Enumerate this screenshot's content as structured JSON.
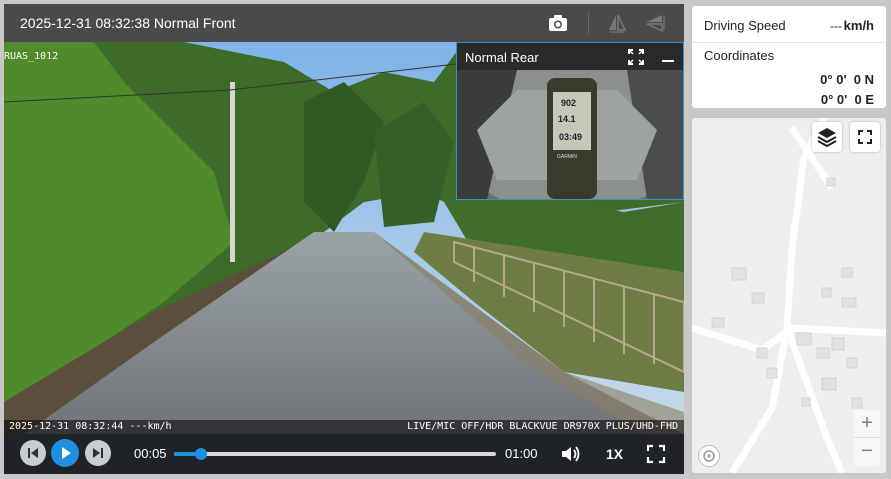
{
  "player": {
    "title": "2025-12-31 08:32:38 Normal Front",
    "osd_top_left": "RUAS_1012",
    "osd_bottom_left": "2025-12-31 08:32:44 ---km/h",
    "osd_bottom_right": "LIVE/MIC OFF/HDR BLACKVUE DR970X PLUS/UHD-FHD",
    "icons": [
      "camera-icon",
      "flip-horizontal-icon",
      "flip-vertical-icon"
    ]
  },
  "rear": {
    "label": "Normal Rear",
    "gps_readings": [
      "902",
      "14.1",
      "03:49"
    ],
    "gps_brand": "GARMIN"
  },
  "controls": {
    "current_time": "00:05",
    "duration": "01:00",
    "progress": 0.083,
    "speed": "1X",
    "accent": "#1f8fe0"
  },
  "info": {
    "speed_label": "Driving Speed",
    "speed_value": "---",
    "speed_unit": "km/h",
    "coords_label": "Coordinates",
    "lat": "0° 0'  0 N",
    "lon": "0° 0'  0 E"
  },
  "map": {
    "zoom_in": "+",
    "zoom_out": "−"
  }
}
